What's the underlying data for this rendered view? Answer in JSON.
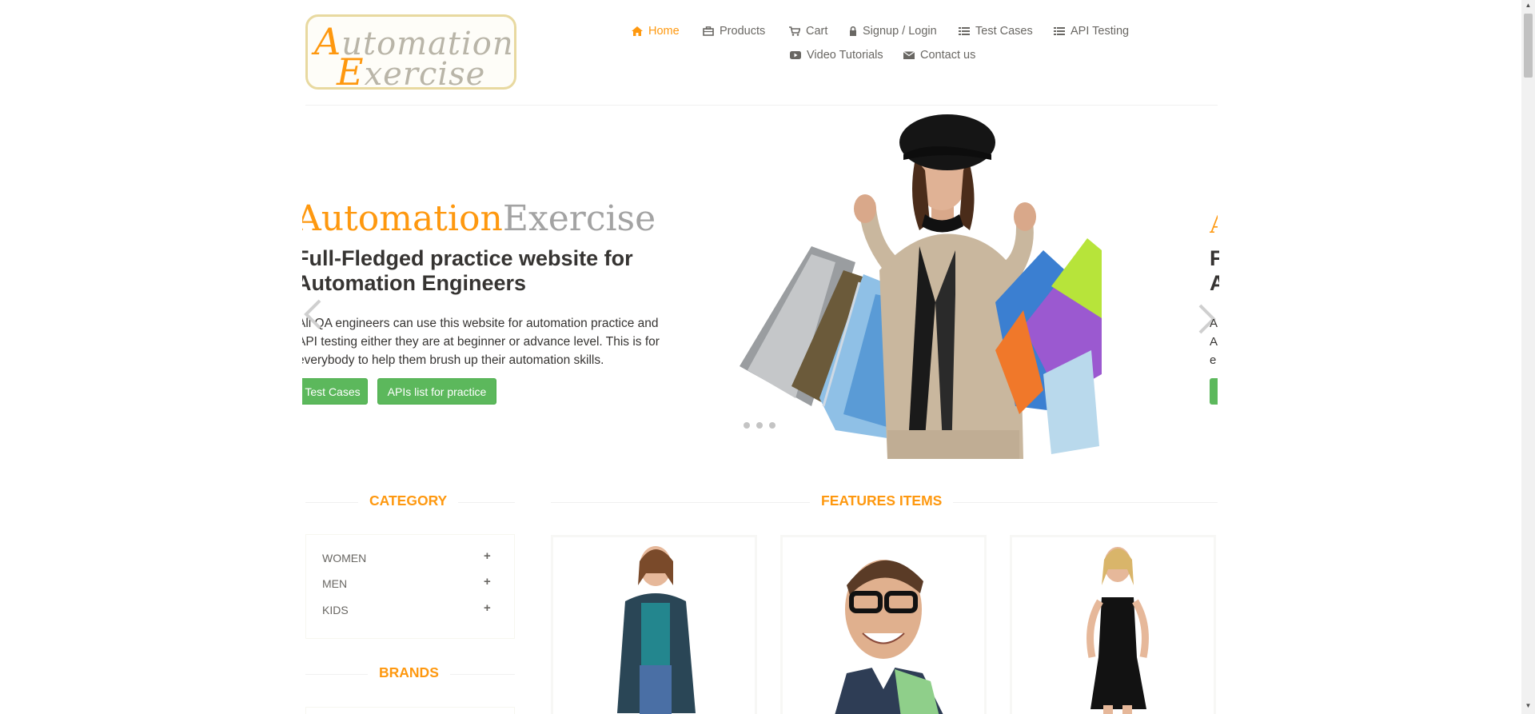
{
  "logo": {
    "line1_cap": "A",
    "line1_rest": "utomation",
    "line2_cap": "E",
    "line2_rest": "xercise"
  },
  "nav": {
    "home": "Home",
    "products": "Products",
    "cart": "Cart",
    "signup": "Signup / Login",
    "test_cases": "Test Cases",
    "api_testing": "API Testing",
    "video_tutorials": "Video Tutorials",
    "contact": "Contact us"
  },
  "slider": {
    "title_a": "Automation",
    "title_b": "Exercise",
    "heading": "Full-Fledged practice website for Automation Engineers",
    "description": "All QA engineers can use this website for automation practice and API testing either they are at beginner or advance level. This is for everybody to help them brush up their automation skills.",
    "btn_test_cases": "Test Cases",
    "btn_apis": "APIs list for practice",
    "next_title": "A",
    "next_h1": "F",
    "next_h2": "A",
    "next_d1": "A",
    "next_d2": "A",
    "next_d3": "e"
  },
  "sidebar": {
    "category_title": "CATEGORY",
    "categories": [
      {
        "label": "WOMEN"
      },
      {
        "label": "MEN"
      },
      {
        "label": "KIDS"
      }
    ],
    "brands_title": "BRANDS"
  },
  "main": {
    "features_title": "FEATURES ITEMS"
  },
  "colors": {
    "accent": "#fe980f",
    "button": "#5cb85c",
    "text": "#696763",
    "heading": "#363432"
  },
  "icons": {
    "home": "home-icon",
    "products": "briefcase-icon",
    "cart": "cart-icon",
    "signup": "lock-icon",
    "test_cases": "list-icon",
    "api_testing": "list-icon",
    "video": "youtube-play-icon",
    "contact": "envelope-icon"
  }
}
